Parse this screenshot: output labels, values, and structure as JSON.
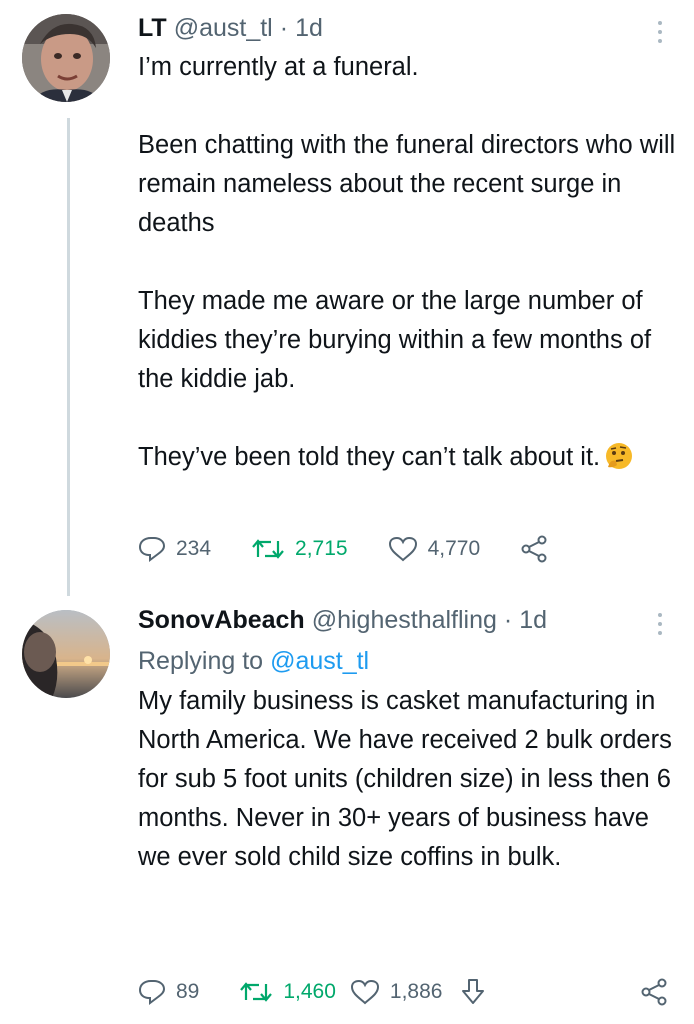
{
  "tweet1": {
    "name": "LT",
    "handle": "@aust_tl",
    "separator": "·",
    "time": "1d",
    "paragraphs": [
      "I’m currently at a funeral.",
      "Been chatting with the funeral directors who will remain nameless about the recent surge in deaths",
      "They made me aware or the large number of kiddies they’re burying within a few months of the kiddie jab.",
      "They’ve been told they can’t talk about it."
    ],
    "emoji": "thinking-face-emoji",
    "replies": "234",
    "retweets": "2,715",
    "likes": "4,770"
  },
  "tweet2": {
    "name": "SonovAbeach",
    "handle": "@highesthalfling",
    "separator": "·",
    "time": "1d",
    "replying_prefix": "Replying to",
    "replying_to": "@aust_tl",
    "text": "My family business is casket manufacturing in North America. We have received 2 bulk orders for sub 5 foot units (children size) in less then 6 months. Never in 30+ years of business have we ever sold child size coffins in bulk.",
    "replies": "89",
    "retweets": "1,460",
    "likes": "1,886"
  },
  "colors": {
    "text": "#0f1419",
    "muted": "#536471",
    "link": "#1d9bf0",
    "retweet_green": "#00a86b",
    "thread_line": "#cfd9de"
  },
  "icons": [
    "reply-icon",
    "retweet-icon",
    "like-icon",
    "share-icon",
    "download-icon",
    "more-icon"
  ]
}
